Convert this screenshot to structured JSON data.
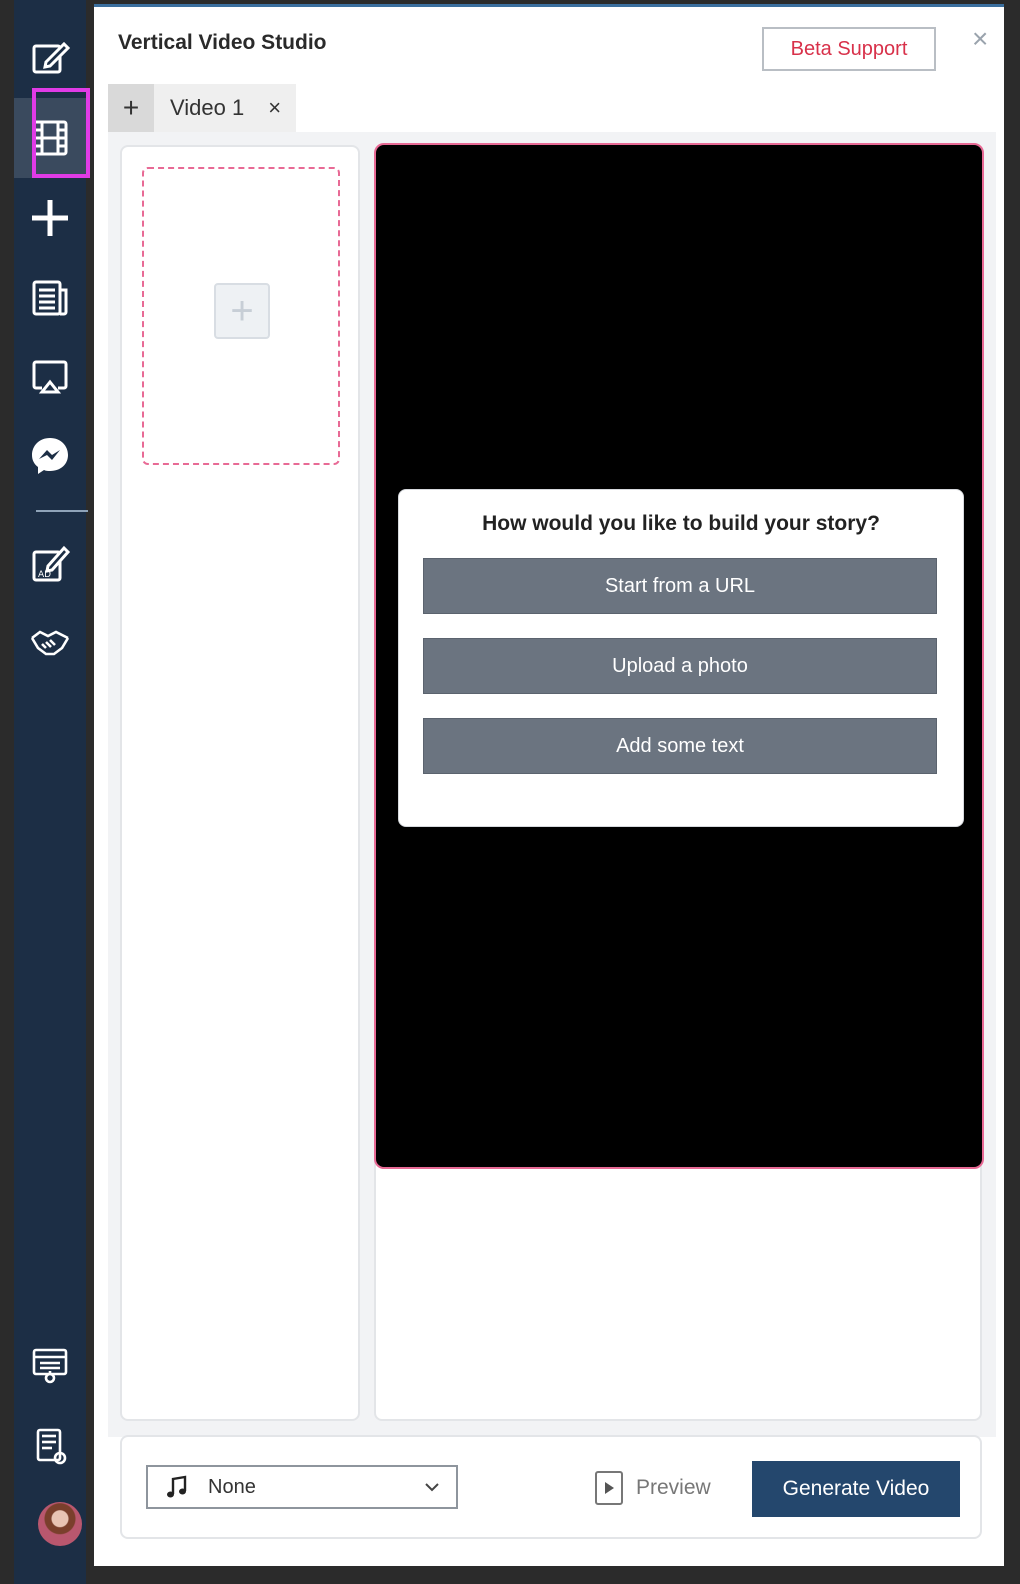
{
  "window": {
    "title": "Vertical Video Studio",
    "beta_support_label": "Beta Support",
    "close_glyph": "×"
  },
  "sidebar": {
    "items": [
      {
        "icon": "edit-icon"
      },
      {
        "icon": "film-icon",
        "active": true
      },
      {
        "icon": "plus-icon"
      },
      {
        "icon": "newspaper-icon"
      },
      {
        "icon": "airplay-icon"
      },
      {
        "icon": "messenger-icon"
      },
      {
        "icon": "ad-edit-icon"
      },
      {
        "icon": "handshake-icon"
      },
      {
        "icon": "presentation-icon"
      },
      {
        "icon": "document-settings-icon"
      }
    ],
    "accent": "#e03be6"
  },
  "tabs": {
    "add_glyph": "+",
    "items": [
      {
        "label": "Video 1",
        "close_glyph": "×"
      }
    ]
  },
  "scenes": {
    "add_glyph": "+"
  },
  "story_prompt": {
    "title": "How would you like to build your story?",
    "options": [
      "Start from a URL",
      "Upload a photo",
      "Add some text"
    ]
  },
  "bottom_bar": {
    "music": {
      "selected": "None",
      "icon": "music-note-icon"
    },
    "preview_label": "Preview",
    "generate_label": "Generate Video"
  },
  "colors": {
    "sidebar_bg": "#1c2e45",
    "primary_button": "#24476d",
    "beta_text": "#d8314a",
    "scene_border": "#e86a95"
  }
}
